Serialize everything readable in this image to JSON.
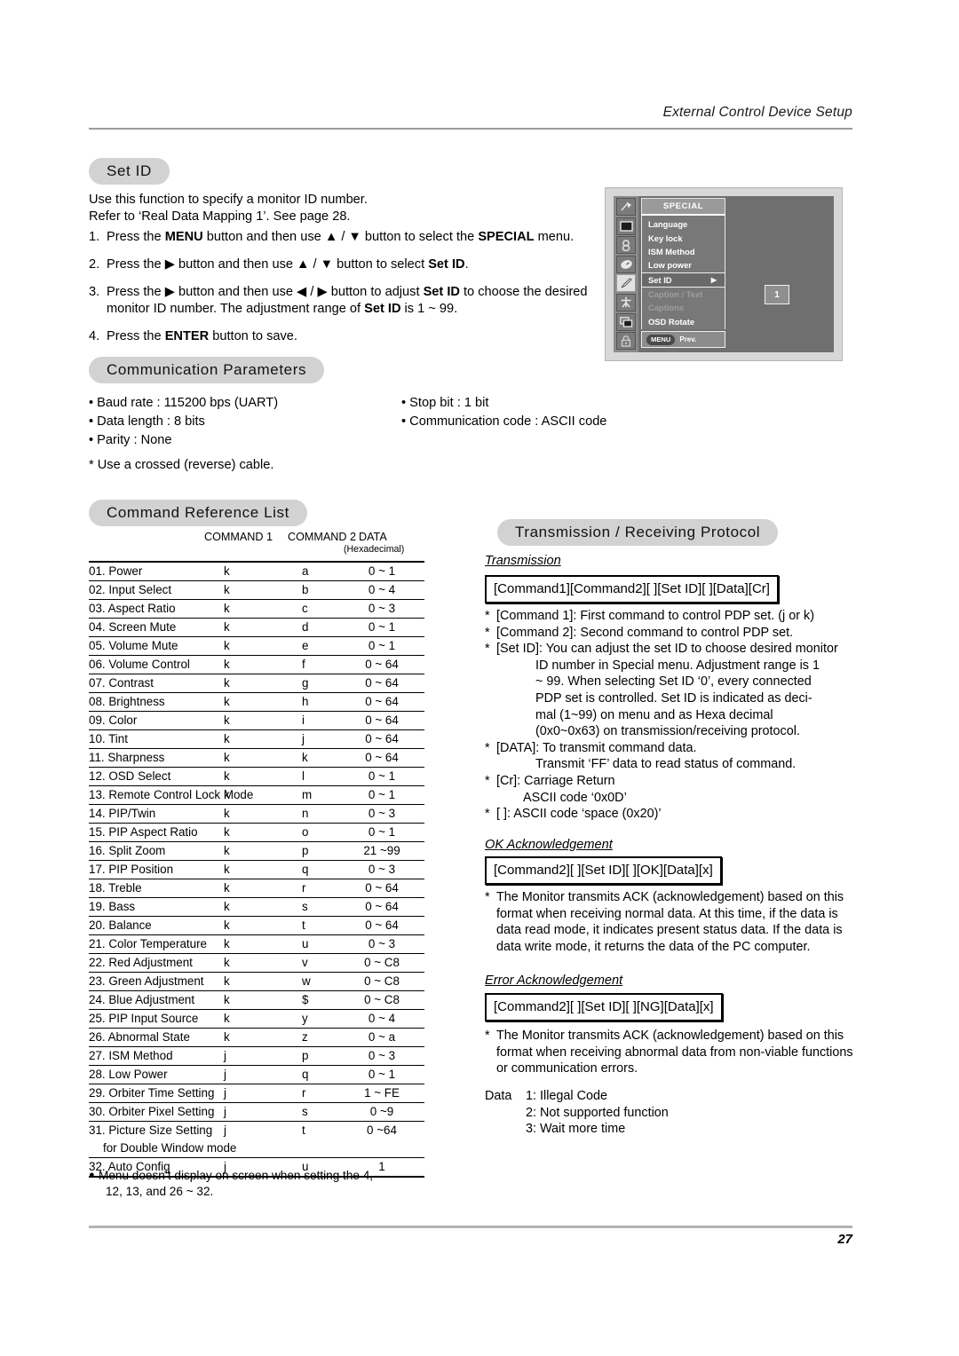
{
  "header": {
    "running_title": "External Control Device Setup"
  },
  "sections": {
    "set_id": {
      "pill_label": "Set ID",
      "intro_line1": "Use this function to specify a monitor ID number.",
      "intro_line2": "Refer to ‘Real Data Mapping 1’. See page 28.",
      "steps": [
        {
          "num": "1.",
          "html": "Press the <b>MENU</b> button and then use ▲ / ▼ button to select the <b>SPECIAL</b> menu."
        },
        {
          "num": "2.",
          "html": "Press the ▶ button and then use ▲ / ▼ button to select <b>Set ID</b>."
        },
        {
          "num": "3.",
          "html": "Press the ▶ button and then use ◀ / ▶ button to adjust <b>Set ID</b> to choose the desired monitor ID number. The adjustment range of <b>Set ID</b> is 1 ~ 99."
        },
        {
          "num": "4.",
          "html": "Press the <b>ENTER</b> button to save."
        }
      ]
    },
    "osd": {
      "title": "SPECIAL",
      "items": [
        {
          "label": "Language",
          "state": "normal"
        },
        {
          "label": "Key lock",
          "state": "normal"
        },
        {
          "label": "ISM Method",
          "state": "normal"
        },
        {
          "label": "Low power",
          "state": "normal"
        },
        {
          "label": "Set ID",
          "state": "highlight",
          "arrow": "▶"
        },
        {
          "label": "Caption / Text",
          "state": "disabled"
        },
        {
          "label": "Captions",
          "state": "disabled"
        },
        {
          "label": "OSD Rotate",
          "state": "normal"
        }
      ],
      "value": "1",
      "footer_button": "MENU",
      "footer_label": "Prev.",
      "rail_icons": [
        "antenna-icon",
        "picture-icon",
        "audio-icon",
        "clock-icon",
        "special-icon",
        "setup-icon",
        "pip-icon",
        "lock-icon"
      ]
    },
    "comm": {
      "pill_label": "Communication Parameters",
      "left": [
        "• Baud rate : 115200 bps (UART)",
        "• Data length : 8 bits",
        "• Parity : None"
      ],
      "right": [
        "• Stop bit : 1 bit",
        "• Communication code : ASCII code"
      ],
      "footnote": "* Use a crossed (reverse) cable."
    },
    "command_list": {
      "pill_label": "Command Reference List",
      "columns": {
        "c1": "COMMAND 1",
        "c2": "COMMAND 2",
        "data": "DATA",
        "data_sub": "(Hexadecimal)"
      },
      "rows": [
        {
          "name": "01. Power",
          "c1": "k",
          "c2": "a",
          "data": "0 ~ 1"
        },
        {
          "name": "02. Input Select",
          "c1": "k",
          "c2": "b",
          "data": "0 ~ 4"
        },
        {
          "name": "03. Aspect Ratio",
          "c1": "k",
          "c2": "c",
          "data": "0 ~ 3"
        },
        {
          "name": "04. Screen Mute",
          "c1": "k",
          "c2": "d",
          "data": "0 ~ 1"
        },
        {
          "name": "05. Volume Mute",
          "c1": "k",
          "c2": "e",
          "data": "0 ~ 1"
        },
        {
          "name": "06. Volume Control",
          "c1": "k",
          "c2": "f",
          "data": "0 ~ 64"
        },
        {
          "name": "07. Contrast",
          "c1": "k",
          "c2": "g",
          "data": "0 ~ 64"
        },
        {
          "name": "08. Brightness",
          "c1": "k",
          "c2": "h",
          "data": "0 ~ 64"
        },
        {
          "name": "09. Color",
          "c1": "k",
          "c2": "i",
          "data": "0 ~ 64"
        },
        {
          "name": "10. Tint",
          "c1": "k",
          "c2": "j",
          "data": "0 ~ 64"
        },
        {
          "name": "11. Sharpness",
          "c1": "k",
          "c2": "k",
          "data": "0 ~ 64"
        },
        {
          "name": "12. OSD Select",
          "c1": "k",
          "c2": "l",
          "data": "0 ~ 1"
        },
        {
          "name": "13. Remote Control Lock Mode",
          "c1": "k",
          "c2": "m",
          "data": "0 ~ 1"
        },
        {
          "name": "14. PIP/Twin",
          "c1": "k",
          "c2": "n",
          "data": "0 ~ 3"
        },
        {
          "name": "15. PIP Aspect Ratio",
          "c1": "k",
          "c2": "o",
          "data": "0 ~ 1"
        },
        {
          "name": "16. Split Zoom",
          "c1": "k",
          "c2": "p",
          "data": "21 ~99"
        },
        {
          "name": "17. PIP Position",
          "c1": "k",
          "c2": "q",
          "data": "0 ~ 3"
        },
        {
          "name": "18. Treble",
          "c1": "k",
          "c2": "r",
          "data": "0 ~ 64"
        },
        {
          "name": "19. Bass",
          "c1": "k",
          "c2": "s",
          "data": "0 ~ 64"
        },
        {
          "name": "20. Balance",
          "c1": "k",
          "c2": "t",
          "data": "0 ~ 64"
        },
        {
          "name": "21. Color Temperature",
          "c1": "k",
          "c2": "u",
          "data": "0 ~ 3"
        },
        {
          "name": "22. Red Adjustment",
          "c1": "k",
          "c2": "v",
          "data": "0 ~ C8"
        },
        {
          "name": "23. Green Adjustment",
          "c1": "k",
          "c2": "w",
          "data": "0 ~ C8"
        },
        {
          "name": "24. Blue Adjustment",
          "c1": "k",
          "c2": "$",
          "data": "0 ~ C8"
        },
        {
          "name": "25. PIP Input Source",
          "c1": "k",
          "c2": "y",
          "data": "0 ~ 4"
        },
        {
          "name": "26. Abnormal State",
          "c1": "k",
          "c2": "z",
          "data": "0 ~ a"
        },
        {
          "name": "27. ISM Method",
          "c1": "j",
          "c2": "p",
          "data": "0 ~ 3"
        },
        {
          "name": "28. Low Power",
          "c1": "j",
          "c2": "q",
          "data": "0 ~ 1"
        },
        {
          "name": "29. Orbiter Time Setting",
          "c1": "j",
          "c2": "r",
          "data": "1 ~ FE"
        },
        {
          "name": "30. Orbiter Pixel Setting",
          "c1": "j",
          "c2": "s",
          "data": "0 ~9"
        },
        {
          "name": "31. Picture Size Setting",
          "c1": "j",
          "c2": "t",
          "data": "0 ~64",
          "sub": "for Double Window mode"
        },
        {
          "name": "32. Auto Config",
          "c1": "j",
          "c2": "u",
          "data": "1"
        }
      ],
      "note_line1": "Menu doesn’t display on screen when setting the 4,",
      "note_line2": "12, 13, and 26 ~ 32."
    },
    "protocol": {
      "pill_label": "Transmission / Receiving  Protocol",
      "transmission": {
        "heading": "Transmission",
        "box": "[Command1][Command2][  ][Set ID][  ][Data][Cr]",
        "notes": [
          {
            "star": "*",
            "text": "[Command 1]: First command to control PDP set. (j or k)"
          },
          {
            "star": "*",
            "text": "[Command 2]: Second command to control PDP set."
          },
          {
            "star": "*",
            "text": "[Set ID]: You can adjust the set ID to choose desired monitor",
            "cont": "ID number in Special menu. Adjustment range is 1 ~ 99. When selecting Set ID ‘0’, every connected PDP set is controlled. Set ID is indicated as deci-mal (1~99) on menu and as Hexa decimal (0x0~0x63) on transmission/receiving protocol."
          },
          {
            "star": "*",
            "text": "[DATA]: To transmit command data.",
            "cont": "Transmit ‘FF’ data to read status of command."
          },
          {
            "star": "*",
            "text": "[Cr]: Carriage Return",
            "cont": "ASCII code ‘0x0D’"
          },
          {
            "star": "*",
            "text": "[   ]: ASCII code ‘space (0x20)’"
          }
        ],
        "setid_lines": [
          "ID number in Special menu. Adjustment range is 1",
          "~ 99. When selecting Set ID ‘0’, every connected",
          "PDP set is controlled. Set ID is indicated as deci-",
          "mal (1~99) on menu and as Hexa decimal",
          "(0x0~0x63) on transmission/receiving protocol."
        ],
        "data_cont": "Transmit ‘FF’ data to read status of command.",
        "cr_cont": "ASCII code ‘0x0D’"
      },
      "ok_ack": {
        "heading": "OK Acknowledgement",
        "box": "[Command2][  ][Set ID][  ][OK][Data][x]",
        "star": "*",
        "text": "The Monitor transmits ACK (acknowledgement) based on this format when receiving normal data. At this time, if the data is data read mode, it indicates present status data. If the data is data write mode, it returns the data of the PC computer."
      },
      "error_ack": {
        "heading": "Error Acknowledgement",
        "box": "[Command2][  ][Set ID][  ][NG][Data][x]",
        "star": "*",
        "text": "The Monitor transmits ACK (acknowledgement) based on this format when receiving abnormal data from non-viable functions or communication errors.",
        "data_label": "Data",
        "data_items": [
          "1: Illegal Code",
          "2: Not supported function",
          "3: Wait more time"
        ]
      }
    }
  },
  "footer": {
    "page_number": "27"
  }
}
